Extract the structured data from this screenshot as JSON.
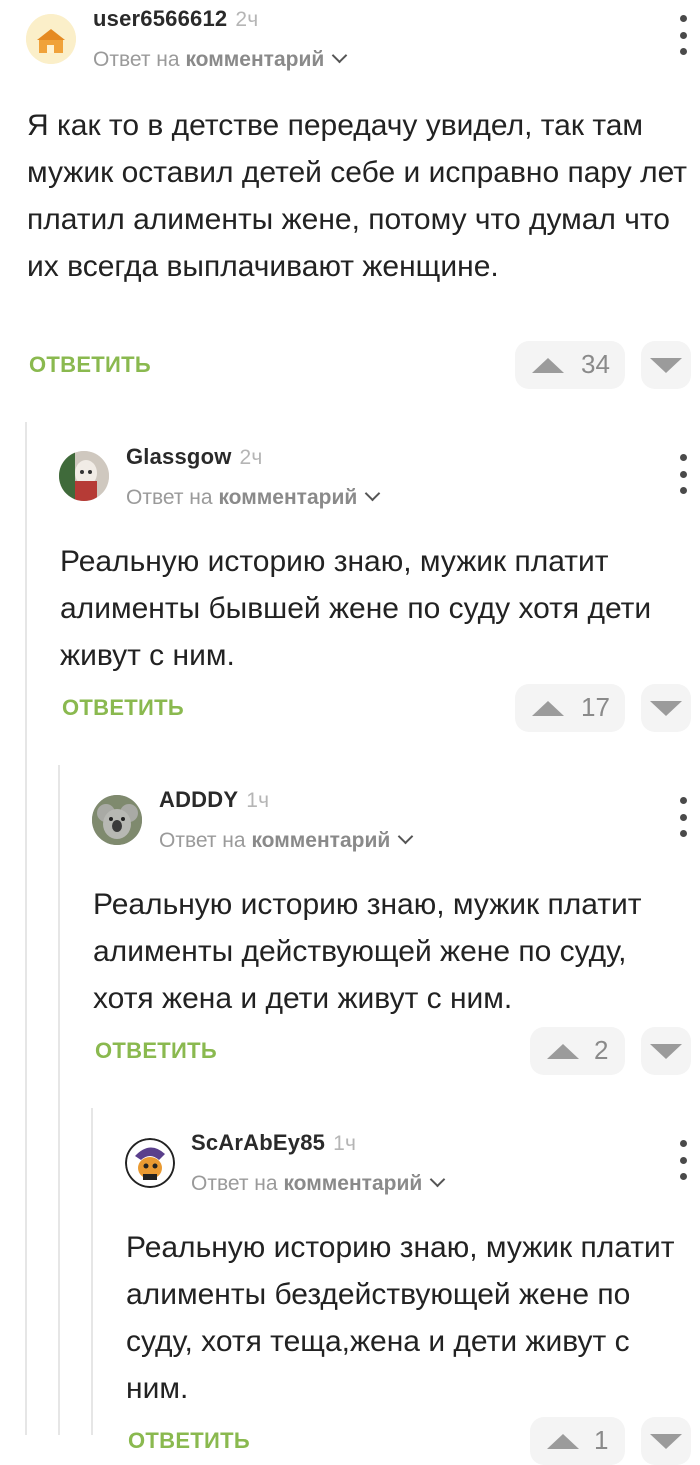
{
  "comments": [
    {
      "username": "user6566612",
      "time": "2ч",
      "reply_prefix": "Ответ на",
      "reply_target": "комментарий",
      "text": "Я как то в детстве передачу увидел, так там мужик оставил детей себе и исправно пару лет платил алименты жене, потому что думал что их всегда выплачивают женщине.",
      "reply_label": "ОТВЕТИТЬ",
      "rating": "34"
    },
    {
      "username": "Glassgow",
      "time": "2ч",
      "reply_prefix": "Ответ на",
      "reply_target": "комментарий",
      "text": "Реальную историю знаю, мужик платит алименты бывшей жене по суду хотя дети живут с ним.",
      "reply_label": "ОТВЕТИТЬ",
      "rating": "17"
    },
    {
      "username": "ADDDY",
      "time": "1ч",
      "reply_prefix": "Ответ на",
      "reply_target": "комментарий",
      "text": "Реальную историю знаю, мужик платит алименты действующей жене по суду, хотя жена и дети живут с ним.",
      "reply_label": "ОТВЕТИТЬ",
      "rating": "2"
    },
    {
      "username": "ScArAbEy85",
      "time": "1ч",
      "reply_prefix": "Ответ на",
      "reply_target": "комментарий",
      "text": "Реальную историю знаю, мужик платит алименты бездействующей жене по суду, хотя теща,жена и дети живут с ним.",
      "reply_label": "ОТВЕТИТЬ",
      "rating": "1"
    }
  ],
  "colors": {
    "reply_green": "#8ab94f",
    "thread_line": "#e6e6e6",
    "vote_bg": "#f4f4f4"
  }
}
